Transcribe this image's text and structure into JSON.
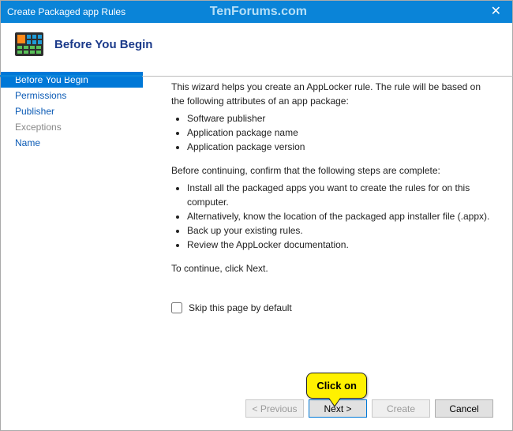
{
  "titlebar": {
    "title": "Create Packaged app Rules",
    "watermark": "TenForums.com",
    "close_icon": "✕"
  },
  "header": {
    "title": "Before You Begin"
  },
  "nav": {
    "items": [
      {
        "label": "Before You Begin",
        "state": "active"
      },
      {
        "label": "Permissions",
        "state": "link"
      },
      {
        "label": "Publisher",
        "state": "link"
      },
      {
        "label": "Exceptions",
        "state": "disabled"
      },
      {
        "label": "Name",
        "state": "link"
      }
    ]
  },
  "content": {
    "intro": "This wizard helps you create an AppLocker rule. The rule will be based on the following attributes of an app package:",
    "attrs": [
      "Software publisher",
      "Application package name",
      "Application package version"
    ],
    "confirm": "Before continuing, confirm that the following steps are complete:",
    "steps": [
      "Install all the packaged apps you want to create the rules for on this computer.",
      "Alternatively, know the location of the packaged app installer file (.appx).",
      "Back up your existing rules.",
      "Review the AppLocker documentation."
    ],
    "continue": "To continue, click Next.",
    "skip_label": "Skip this page by default"
  },
  "buttons": {
    "previous": "< Previous",
    "next": "Next >",
    "create": "Create",
    "cancel": "Cancel"
  },
  "callout": {
    "text": "Click on"
  }
}
